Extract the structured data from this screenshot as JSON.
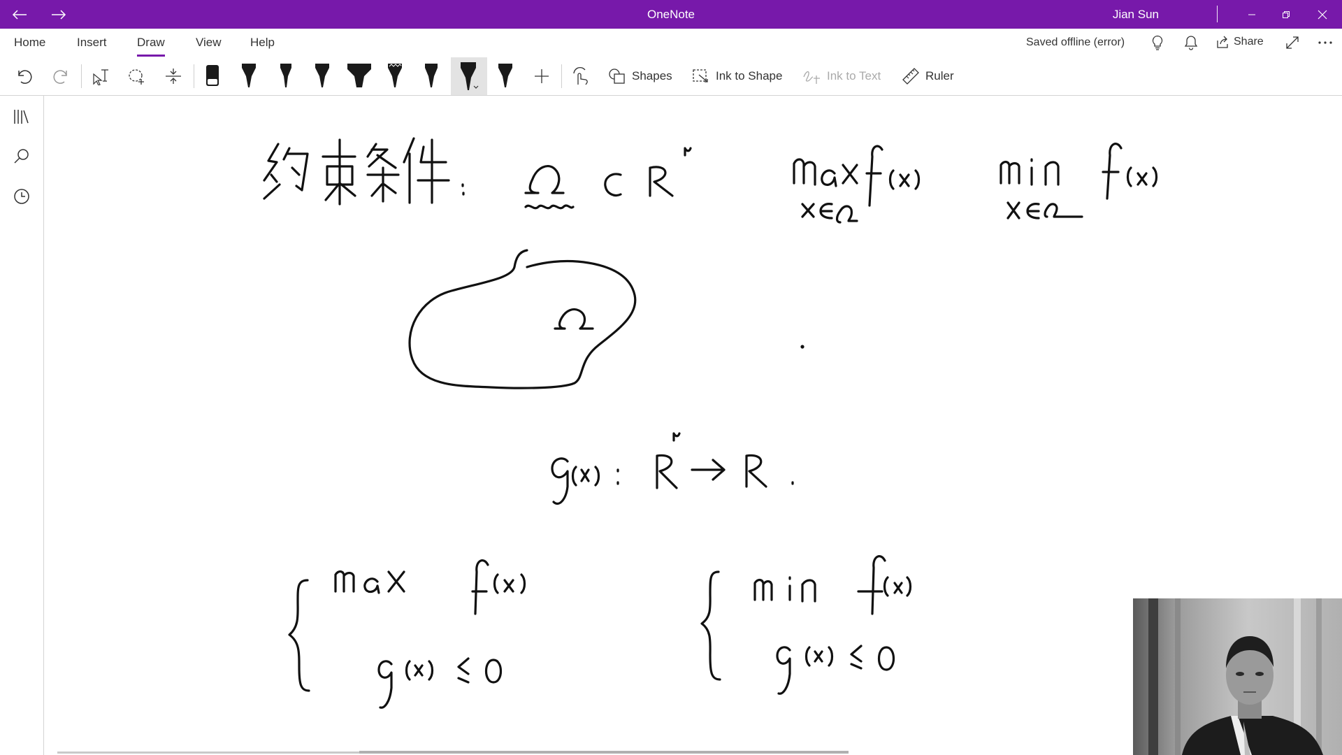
{
  "titlebar": {
    "title": "OneNote",
    "user": "Jian Sun",
    "back_icon": "arrow-left-icon",
    "forward_icon": "arrow-right-icon"
  },
  "tabs": [
    {
      "label": "Home"
    },
    {
      "label": "Insert"
    },
    {
      "label": "Draw"
    },
    {
      "label": "View"
    },
    {
      "label": "Help"
    }
  ],
  "active_tab": "Draw",
  "status": {
    "saved": "Saved offline (error)",
    "share": "Share"
  },
  "toolbar": {
    "shapes": "Shapes",
    "ink_to_shape": "Ink to Shape",
    "ink_to_text": "Ink to Text",
    "ruler": "Ruler"
  },
  "colors": {
    "brand": "#7719aa",
    "ink": "#111111"
  },
  "note_ink": {
    "line1": [
      "约束条件",
      "Ω ⊂ Rⁿ",
      "max f(x), x∈Ω",
      "min f(x), x∈Ω"
    ],
    "region_label": "Ω",
    "line2": "g(x): Rⁿ → R.",
    "system_left": [
      "max f(x)",
      "g(x) ≤ 0"
    ],
    "system_right": [
      "min f(x)",
      "g(x) ≤ 0"
    ]
  }
}
